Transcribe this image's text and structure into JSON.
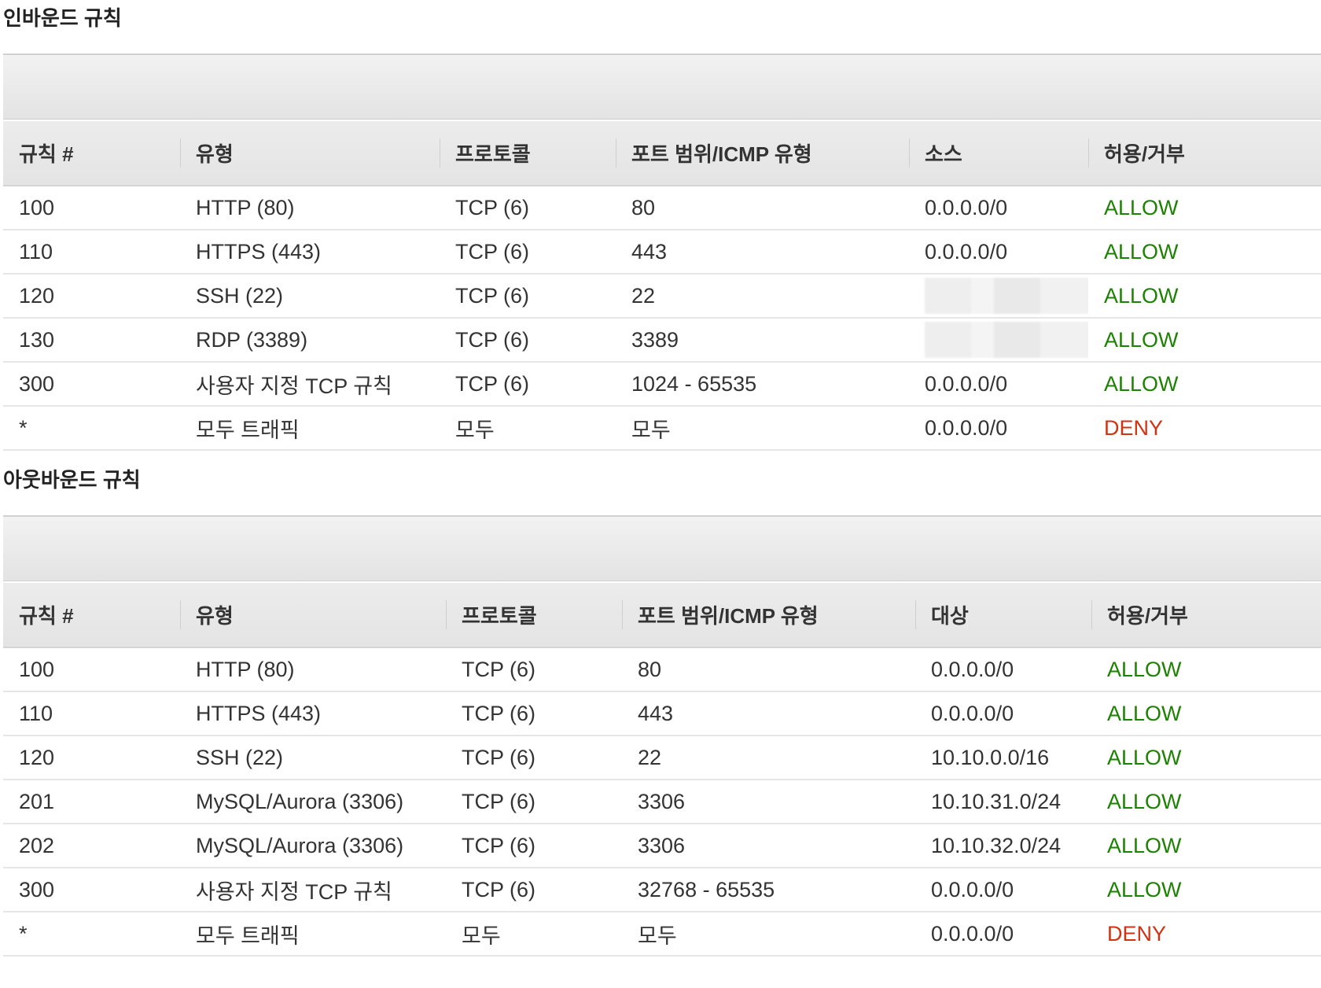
{
  "inbound": {
    "title": "인바운드 규칙",
    "columns": [
      "규칙 #",
      "유형",
      "프로토콜",
      "포트 범위/ICMP 유형",
      "소스",
      "허용/거부"
    ],
    "rows": [
      {
        "num": "100",
        "type": "HTTP (80)",
        "protocol": "TCP (6)",
        "port": "80",
        "addr": "0.0.0.0/0",
        "action": "ALLOW"
      },
      {
        "num": "110",
        "type": "HTTPS (443)",
        "protocol": "TCP (6)",
        "port": "443",
        "addr": "0.0.0.0/0",
        "action": "ALLOW"
      },
      {
        "num": "120",
        "type": "SSH (22)",
        "protocol": "TCP (6)",
        "port": "22",
        "addr": "",
        "action": "ALLOW"
      },
      {
        "num": "130",
        "type": "RDP (3389)",
        "protocol": "TCP (6)",
        "port": "3389",
        "addr": "",
        "action": "ALLOW"
      },
      {
        "num": "300",
        "type": "사용자 지정 TCP 규칙",
        "protocol": "TCP (6)",
        "port": "1024 - 65535",
        "addr": "0.0.0.0/0",
        "action": "ALLOW"
      },
      {
        "num": "*",
        "type": "모두 트래픽",
        "protocol": "모두",
        "port": "모두",
        "addr": "0.0.0.0/0",
        "action": "DENY"
      }
    ]
  },
  "outbound": {
    "title": "아웃바운드 규칙",
    "columns": [
      "규칙 #",
      "유형",
      "프로토콜",
      "포트 범위/ICMP 유형",
      "대상",
      "허용/거부"
    ],
    "rows": [
      {
        "num": "100",
        "type": "HTTP (80)",
        "protocol": "TCP (6)",
        "port": "80",
        "addr": "0.0.0.0/0",
        "action": "ALLOW"
      },
      {
        "num": "110",
        "type": "HTTPS (443)",
        "protocol": "TCP (6)",
        "port": "443",
        "addr": "0.0.0.0/0",
        "action": "ALLOW"
      },
      {
        "num": "120",
        "type": "SSH (22)",
        "protocol": "TCP (6)",
        "port": "22",
        "addr": "10.10.0.0/16",
        "action": "ALLOW"
      },
      {
        "num": "201",
        "type": "MySQL/Aurora (3306)",
        "protocol": "TCP (6)",
        "port": "3306",
        "addr": "10.10.31.0/24",
        "action": "ALLOW"
      },
      {
        "num": "202",
        "type": "MySQL/Aurora (3306)",
        "protocol": "TCP (6)",
        "port": "3306",
        "addr": "10.10.32.0/24",
        "action": "ALLOW"
      },
      {
        "num": "300",
        "type": "사용자 지정 TCP 규칙",
        "protocol": "TCP (6)",
        "port": "32768 - 65535",
        "addr": "0.0.0.0/0",
        "action": "ALLOW"
      },
      {
        "num": "*",
        "type": "모두 트래픽",
        "protocol": "모두",
        "port": "모두",
        "addr": "0.0.0.0/0",
        "action": "DENY"
      }
    ]
  },
  "colors": {
    "allow": "#1d8102",
    "deny": "#d13212"
  }
}
